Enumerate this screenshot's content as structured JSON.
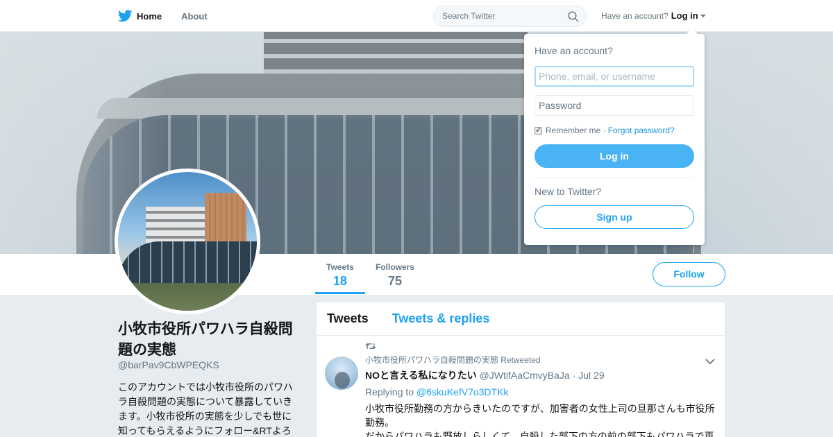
{
  "nav": {
    "home_label": "Home",
    "about_label": "About",
    "search_placeholder": "Search Twitter",
    "have_account_text": "Have an account?",
    "login_label": "Log in"
  },
  "profile": {
    "stats": [
      {
        "label": "Tweets",
        "value": "18"
      },
      {
        "label": "Followers",
        "value": "75"
      }
    ],
    "follow_label": "Follow",
    "name": "小牧市役所パワハラ自殺問題の実態",
    "handle": "@barPav9CbWPEQKS",
    "bio": "このアカウントでは小牧市役所のパワハラ自殺問題の実態について暴露していきます。小牧市役所の実態を少しでも世に知ってもらえるようにフォロー&RTよろ"
  },
  "timeline": {
    "tabs": [
      "Tweets",
      "Tweets & replies"
    ],
    "tweet": {
      "retweet_note": "小牧市役所パワハラ自殺問題の実態 Retweeted",
      "name": "NOと言える私になりたい",
      "username": "@JWtifAaCmvyBaJa",
      "date": "· Jul 29",
      "replying_prefix": "Replying to",
      "replying_to": "@6skuKefV7o3DTKk",
      "text_1": "小牧市役所勤務の方からきいたのですが、加害者の女性上司の旦那さんも市役所勤務。",
      "text_2": "だからパワハラも野放しらしくて、自殺した部下の方の前の部下もパワハラで再起不能になったらしいです。"
    }
  },
  "login_dropdown": {
    "title": "Have an account?",
    "username_placeholder": "Phone, email, or username",
    "password_placeholder": "Password",
    "remember_label": "Remember me ·",
    "forgot_label": "Forgot password?",
    "login_button": "Log in",
    "new_prompt": "New to Twitter?",
    "signup_button": "Sign up"
  },
  "colors": {
    "brand": "#1da1f2",
    "background": "#e6ecf0"
  },
  "icons": [
    "twitter-bird-icon",
    "search-icon",
    "retweet-icon",
    "chevron-down-icon",
    "checkbox-checked-icon"
  ]
}
